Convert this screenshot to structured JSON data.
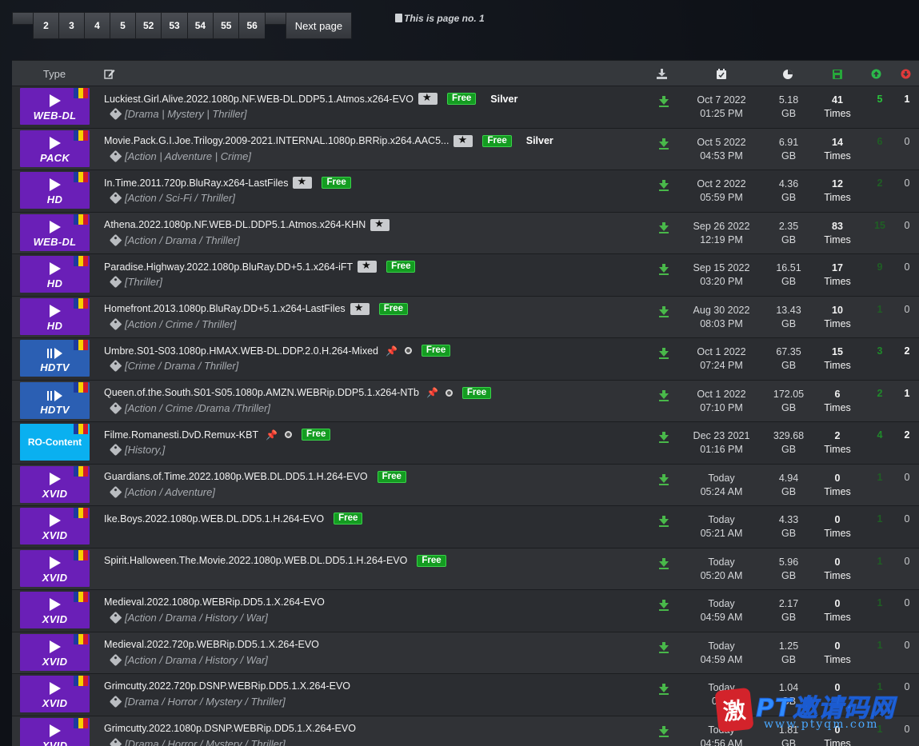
{
  "pagination": {
    "pages": [
      "2",
      "3",
      "4",
      "5",
      "52",
      "53",
      "54",
      "55",
      "56"
    ],
    "next_label": "Next page",
    "page_info": "This is page no. 1"
  },
  "table": {
    "type_header": "Type",
    "header_icons": [
      "edit-icon",
      "download-icon",
      "calendar-icon",
      "pie-chart-icon",
      "save-icon",
      "seeders-up-icon",
      "leechers-down-icon"
    ],
    "colors": {
      "cat_purple": "#6a1fb7",
      "cat_blue": "#2b5fb3",
      "cat_cyan": "#0ab0f0",
      "free_green": "#149c21",
      "seed_green": "#29c23a",
      "leech_red": "#e03a3a"
    },
    "rows": [
      {
        "cat": "WEB-DL",
        "kind": "play",
        "name": "Luckiest.Girl.Alive.2022.1080p.NF.WEB-DL.DDP5.1.Atmos.x264-EVO",
        "star": true,
        "pin": false,
        "free": "Free",
        "silver": "Silver",
        "genres": "[Drama | Mystery | Thriller]",
        "date": "Oct 7 2022",
        "time": "01:25 PM",
        "size": "5.18",
        "unit": "GB",
        "snatched": "41",
        "times": "Times",
        "seeders": "5",
        "seed_style": "bright",
        "leechers": "1",
        "leech_bold": true
      },
      {
        "cat": "PACK",
        "kind": "play",
        "name": "Movie.Pack.G.I.Joe.Trilogy.2009-2021.INTERNAL.1080p.BRRip.x264.AAC5...",
        "star": true,
        "pin": false,
        "free": "Free",
        "silver": "Silver",
        "genres": "[Action | Adventure | Crime]",
        "date": "Oct 5 2022",
        "time": "04:53 PM",
        "size": "6.91",
        "unit": "GB",
        "snatched": "14",
        "times": "Times",
        "seeders": "6",
        "seed_style": "dim",
        "leechers": "0",
        "leech_bold": false
      },
      {
        "cat": "HD",
        "kind": "play",
        "name": "In.Time.2011.720p.BluRay.x264-LastFiles",
        "star": true,
        "pin": false,
        "free": "Free",
        "silver": "",
        "genres": "[Action / Sci-Fi / Thriller]",
        "date": "Oct 2 2022",
        "time": "05:59 PM",
        "size": "4.36",
        "unit": "GB",
        "snatched": "12",
        "times": "Times",
        "seeders": "2",
        "seed_style": "dim",
        "leechers": "0",
        "leech_bold": false
      },
      {
        "cat": "WEB-DL",
        "kind": "play",
        "name": "Athena.2022.1080p.NF.WEB-DL.DDP5.1.Atmos.x264-KHN",
        "star": true,
        "pin": false,
        "free": "",
        "silver": "",
        "genres": "[Action / Drama / Thriller]",
        "date": "Sep 26 2022",
        "time": "12:19 PM",
        "size": "2.35",
        "unit": "GB",
        "snatched": "83",
        "times": "Times",
        "seeders": "15",
        "seed_style": "dim",
        "leechers": "0",
        "leech_bold": false
      },
      {
        "cat": "HD",
        "kind": "play",
        "name": "Paradise.Highway.2022.1080p.BluRay.DD+5.1.x264-iFT",
        "star": true,
        "pin": false,
        "free": "Free",
        "silver": "",
        "genres": "[Thriller]",
        "date": "Sep 15 2022",
        "time": "03:20 PM",
        "size": "16.51",
        "unit": "GB",
        "snatched": "17",
        "times": "Times",
        "seeders": "9",
        "seed_style": "dim",
        "leechers": "0",
        "leech_bold": false
      },
      {
        "cat": "HD",
        "kind": "play",
        "name": "Homefront.2013.1080p.BluRay.DD+5.1.x264-LastFiles",
        "star": true,
        "pin": false,
        "free": "Free",
        "silver": "",
        "genres": "[Action / Crime / Thriller]",
        "date": "Aug 30 2022",
        "time": "08:03 PM",
        "size": "13.43",
        "unit": "GB",
        "snatched": "10",
        "times": "Times",
        "seeders": "1",
        "seed_style": "dim",
        "leechers": "0",
        "leech_bold": false
      },
      {
        "cat": "HDTV",
        "kind": "bars",
        "name": "Umbre.S01-S03.1080p.HMAX.WEB-DL.DDP.2.0.H.264-Mixed",
        "star": false,
        "pin": true,
        "free": "Free",
        "silver": "",
        "genres": "[Crime / Drama / Thriller]",
        "date": "Oct 1 2022",
        "time": "07:24 PM",
        "size": "67.35",
        "unit": "GB",
        "snatched": "15",
        "times": "Times",
        "seeders": "3",
        "seed_style": "normal",
        "leechers": "2",
        "leech_bold": true
      },
      {
        "cat": "HDTV",
        "kind": "bars",
        "name": "Queen.of.the.South.S01-S05.1080p.AMZN.WEBRip.DDP5.1.x264-NTb",
        "star": false,
        "pin": true,
        "free": "Free",
        "silver": "",
        "genres": "[Action / Crime /Drama /Thriller]",
        "date": "Oct 1 2022",
        "time": "07:10 PM",
        "size": "172.05",
        "unit": "GB",
        "snatched": "6",
        "times": "Times",
        "seeders": "2",
        "seed_style": "normal",
        "leechers": "1",
        "leech_bold": true
      },
      {
        "cat": "RO-Content",
        "kind": "ro",
        "name": "Filme.Romanesti.DvD.Remux-KBT",
        "star": false,
        "pin": true,
        "free": "Free",
        "silver": "",
        "genres": "[History,]",
        "date": "Dec 23 2021",
        "time": "01:16 PM",
        "size": "329.68",
        "unit": "GB",
        "snatched": "2",
        "times": "Times",
        "seeders": "4",
        "seed_style": "normal",
        "leechers": "2",
        "leech_bold": true
      },
      {
        "cat": "XVID",
        "kind": "play",
        "name": "Guardians.of.Time.2022.1080p.WEB.DL.DD5.1.H.264-EVO",
        "star": false,
        "pin": false,
        "free": "Free",
        "silver": "",
        "genres": "[Action / Adventure]",
        "date": "Today",
        "time": "05:24 AM",
        "size": "4.94",
        "unit": "GB",
        "snatched": "0",
        "times": "Times",
        "seeders": "1",
        "seed_style": "dim",
        "leechers": "0",
        "leech_bold": false
      },
      {
        "cat": "XVID",
        "kind": "play",
        "name": "Ike.Boys.2022.1080p.WEB.DL.DD5.1.H.264-EVO",
        "star": false,
        "pin": false,
        "free": "Free",
        "silver": "",
        "genres": "",
        "date": "Today",
        "time": "05:21 AM",
        "size": "4.33",
        "unit": "GB",
        "snatched": "0",
        "times": "Times",
        "seeders": "1",
        "seed_style": "dim",
        "leechers": "0",
        "leech_bold": false
      },
      {
        "cat": "XVID",
        "kind": "play",
        "name": "Spirit.Halloween.The.Movie.2022.1080p.WEB.DL.DD5.1.H.264-EVO",
        "star": false,
        "pin": false,
        "free": "Free",
        "silver": "",
        "genres": "",
        "date": "Today",
        "time": "05:20 AM",
        "size": "5.96",
        "unit": "GB",
        "snatched": "0",
        "times": "Times",
        "seeders": "1",
        "seed_style": "dim",
        "leechers": "0",
        "leech_bold": false
      },
      {
        "cat": "XVID",
        "kind": "play",
        "name": "Medieval.2022.1080p.WEBRip.DD5.1.X.264-EVO",
        "star": false,
        "pin": false,
        "free": "",
        "silver": "",
        "genres": "[Action / Drama / History / War]",
        "date": "Today",
        "time": "04:59 AM",
        "size": "2.17",
        "unit": "GB",
        "snatched": "0",
        "times": "Times",
        "seeders": "1",
        "seed_style": "dim",
        "leechers": "0",
        "leech_bold": false
      },
      {
        "cat": "XVID",
        "kind": "play",
        "name": "Medieval.2022.720p.WEBRip.DD5.1.X.264-EVO",
        "star": false,
        "pin": false,
        "free": "",
        "silver": "",
        "genres": "[Action / Drama / History / War]",
        "date": "Today",
        "time": "04:59 AM",
        "size": "1.25",
        "unit": "GB",
        "snatched": "0",
        "times": "Times",
        "seeders": "1",
        "seed_style": "dim",
        "leechers": "0",
        "leech_bold": false
      },
      {
        "cat": "XVID",
        "kind": "play",
        "name": "Grimcutty.2022.720p.DSNP.WEBRip.DD5.1.X.264-EVO",
        "star": false,
        "pin": false,
        "free": "",
        "silver": "",
        "genres": "[Drama / Horror / Mystery / Thriller]",
        "date": "Today",
        "time": "04:5",
        "size": "1.04",
        "unit": "GB",
        "snatched": "0",
        "times": "",
        "seeders": "1",
        "seed_style": "dim",
        "leechers": "0",
        "leech_bold": false
      },
      {
        "cat": "XVID",
        "kind": "play",
        "name": "Grimcutty.2022.1080p.DSNP.WEBRip.DD5.1.X.264-EVO",
        "star": false,
        "pin": false,
        "free": "",
        "silver": "",
        "genres": "[Drama / Horror / Mystery / Thriller]",
        "date": "Today",
        "time": "04:56 AM",
        "size": "1.81",
        "unit": "GB",
        "snatched": "0",
        "times": "Times",
        "seeders": "1",
        "seed_style": "dim",
        "leechers": "0",
        "leech_bold": false
      }
    ]
  },
  "watermark": {
    "seal_char": "激",
    "title": "PT邀请码网",
    "url": "www.ptyqm.com"
  }
}
